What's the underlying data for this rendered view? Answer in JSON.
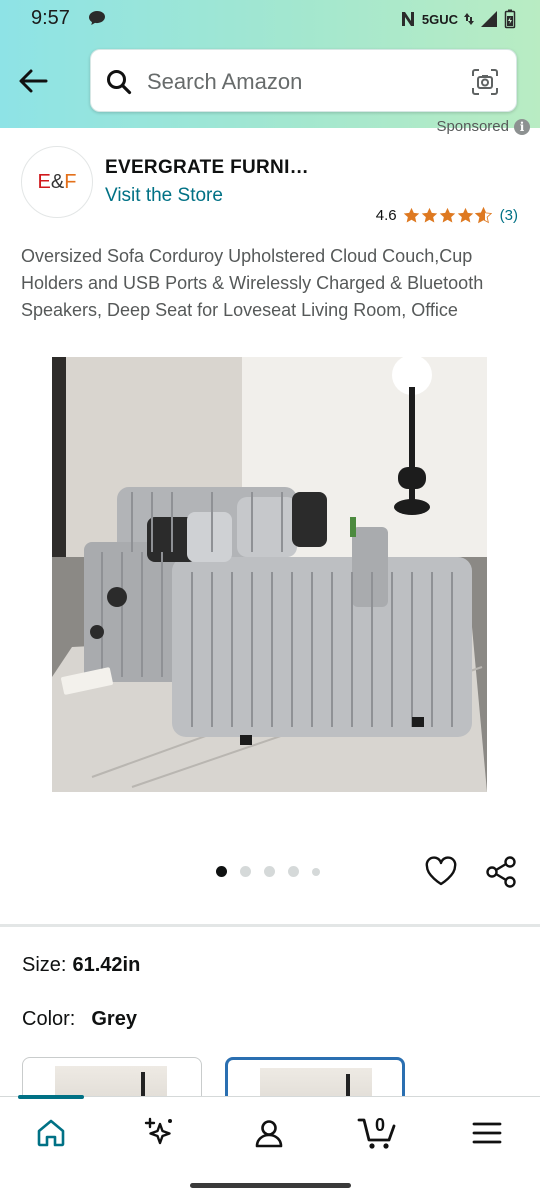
{
  "status_bar": {
    "time": "9:57",
    "network": "5GUC"
  },
  "search": {
    "placeholder": "Search Amazon"
  },
  "sponsored_label": "Sponsored",
  "brand": {
    "logo_text_1": "E",
    "logo_text_2": "&",
    "logo_text_3": "F",
    "name": "EVERGRATE FURNI…",
    "visit_link": "Visit the Store"
  },
  "rating": {
    "value": "4.6",
    "stars": 4.6,
    "count": "(3)"
  },
  "product": {
    "title": "Oversized Sofa Corduroy Upholstered Cloud Couch,Cup Holders and USB Ports & Wirelessly Charged & Bluetooth Speakers, Deep Seat for Loveseat Living Room, Office",
    "image_count": 5,
    "active_image": 1
  },
  "size": {
    "label": "Size:",
    "value": "61.42in"
  },
  "color": {
    "label": "Color:",
    "value": "Grey"
  },
  "bottom_nav": {
    "items": [
      "home-icon",
      "sparkle-icon",
      "account-icon",
      "cart-icon",
      "menu-icon"
    ],
    "cart_count": "0"
  },
  "colors": {
    "link": "#007185",
    "star": "#de7921",
    "selected_border": "#2a6fb1"
  }
}
